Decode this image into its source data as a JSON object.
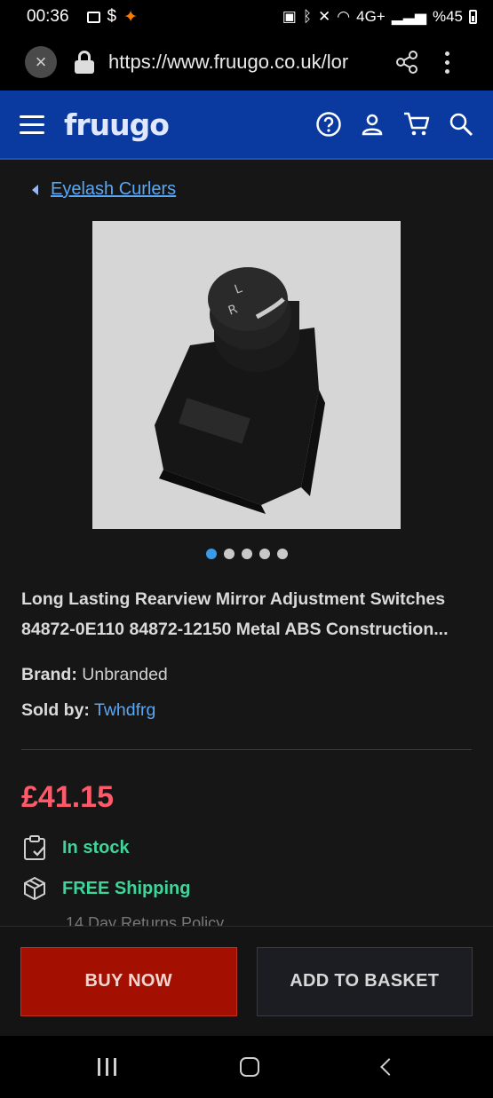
{
  "status_bar": {
    "time": "00:36",
    "dollar": "$",
    "network": "4G+",
    "battery": "%45"
  },
  "browser": {
    "url": "https://www.fruugo.co.uk/lor"
  },
  "site": {
    "logo": "fruugo"
  },
  "breadcrumb": {
    "label": "Eyelash Curlers"
  },
  "carousel": {
    "count": 5,
    "active_index": 0
  },
  "product": {
    "title": "Long Lasting Rearview Mirror Adjustment Switches 84872-0E110 84872-12150 Metal ABS Construction...",
    "brand_label": "Brand:",
    "brand_value": "Unbranded",
    "sold_by_label": "Sold by:",
    "sold_by_value": "Twhdfrg",
    "price": "£41.15",
    "stock": "In stock",
    "shipping": "FREE Shipping",
    "returns_peek": "14 Day Returns Policy"
  },
  "actions": {
    "buy_now": "BUY NOW",
    "add_to_basket": "ADD TO BASKET"
  },
  "colors": {
    "header_blue": "#0a3aa0",
    "price_red": "#ff5a6a",
    "feature_green": "#3fd59a",
    "buy_red": "#a30f00",
    "link_blue": "#5aa7f5"
  }
}
